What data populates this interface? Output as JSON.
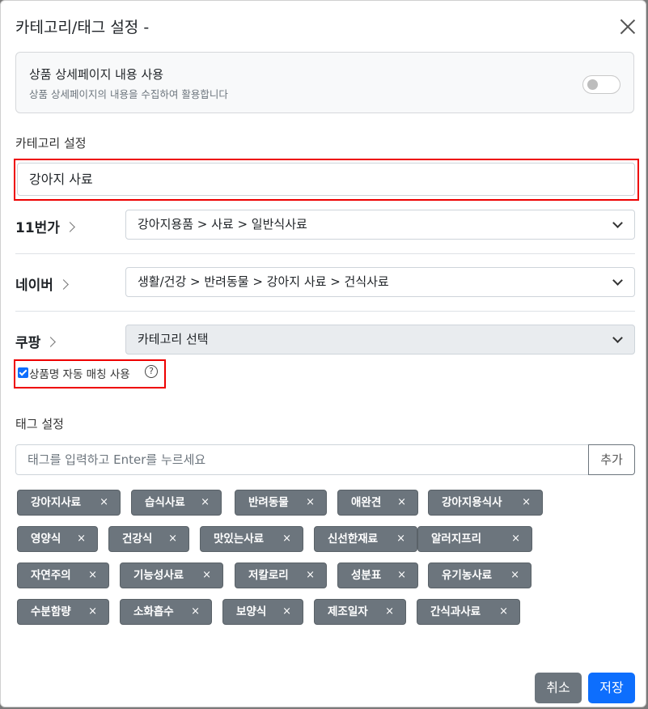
{
  "dialog": {
    "title": "카테고리/태그 설정 -"
  },
  "detail_switch": {
    "title": "상품 상세페이지 내용 사용",
    "desc": "상품 상세페이지의 내용을 수집하여 활용합니다",
    "on": false
  },
  "category": {
    "label": "카테고리 설정",
    "value": "강아지 사료"
  },
  "markets": [
    {
      "name": "11번가",
      "value": "강아지용품 > 사료 > 일반식사료"
    },
    {
      "name": "네이버",
      "value": "생활/건강 > 반려동물 > 강아지 사료 > 건식사료"
    },
    {
      "name": "쿠팡",
      "value": "카테고리 선택"
    }
  ],
  "auto_match": {
    "label": "상품명 자동 매칭 사용",
    "checked": true,
    "help": "?"
  },
  "tags": {
    "label": "태그 설정",
    "placeholder": "태그를 입력하고 Enter를 누르세요",
    "add_label": "추가",
    "remove_glyph": "×",
    "items": [
      "강아지사료",
      "습식사료",
      "반려동물",
      "애완견",
      "강아지용식사",
      "영양식",
      "건강식",
      "맛있는사료",
      "신선한재료",
      "알러지프리",
      "자연주의",
      "기능성사료",
      "저칼로리",
      "성분표",
      "유기농사료",
      "수분함량",
      "소화흡수",
      "보양식",
      "제조일자",
      "간식과사료"
    ]
  },
  "footer": {
    "cancel": "취소",
    "save": "저장"
  }
}
